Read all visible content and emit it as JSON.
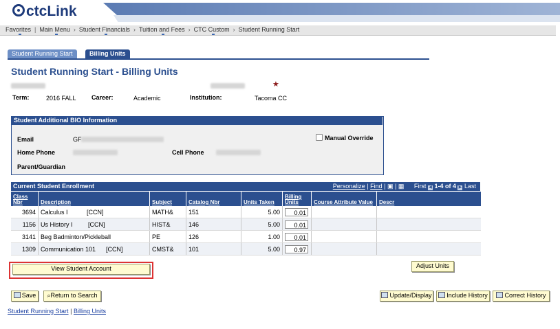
{
  "header": {
    "logo": "ctcLink"
  },
  "breadcrumbs": [
    "Favorites",
    "Main Menu",
    "Student Financials",
    "Tuition and Fees",
    "CTC Custom",
    "Student Running Start"
  ],
  "tabs": [
    {
      "label": "Student Running Start",
      "active": false
    },
    {
      "label": "Billing Units",
      "active": true
    }
  ],
  "page": {
    "title": "Student Running Start - Billing Units",
    "term_label": "Term:",
    "term_value": "2016 FALL",
    "career_label": "Career:",
    "career_value": "Academic",
    "institution_label": "Institution:",
    "institution_value": "Tacoma CC"
  },
  "bio": {
    "header": "Student Additional BIO Information",
    "email_label": "Email",
    "email_value": "GF",
    "home_phone_label": "Home Phone",
    "cell_phone_label": "Cell Phone",
    "parent_label": "Parent/Guardian",
    "manual_override_label": "Manual Override"
  },
  "enrollment": {
    "header": "Current Student Enrollment",
    "personalize": "Personalize",
    "find": "Find",
    "first": "First",
    "range": "1-4 of 4",
    "last": "Last",
    "columns": [
      "Class Nbr",
      "Description",
      "Subject",
      "Catalog Nbr",
      "Units Taken",
      "Billing Units",
      "Course Attribute Value",
      "Descr"
    ],
    "rows": [
      {
        "class_nbr": "3694",
        "description": "Calculus I           [CCN]",
        "subject": "MATH&",
        "catalog": "151",
        "units": "5.00",
        "billing": "0.01"
      },
      {
        "class_nbr": "1156",
        "description": "Us History I         [CCN]",
        "subject": "HIST&",
        "catalog": "146",
        "units": "5.00",
        "billing": "0.01"
      },
      {
        "class_nbr": "3141",
        "description": "Beg Badminton/Pickleball",
        "subject": "PE",
        "catalog": "126",
        "units": "1.00",
        "billing": "0.01"
      },
      {
        "class_nbr": "1309",
        "description": "Communication 101      [CCN]",
        "subject": "CMST&",
        "catalog": "101",
        "units": "5.00",
        "billing": "0.97"
      }
    ]
  },
  "buttons": {
    "view_account": "View Student Account",
    "adjust_units": "Adjust Units",
    "save": "Save",
    "return_search": "Return to Search",
    "update_display": "Update/Display",
    "include_history": "Include History",
    "correct_history": "Correct History"
  },
  "bottom_links": {
    "link1": "Student Running Start",
    "separator": "|",
    "link2": "Billing Units"
  },
  "colors": {
    "brand": "#1d3a7a",
    "header_blue": "#2b4f8f",
    "highlight": "#dd3333"
  }
}
